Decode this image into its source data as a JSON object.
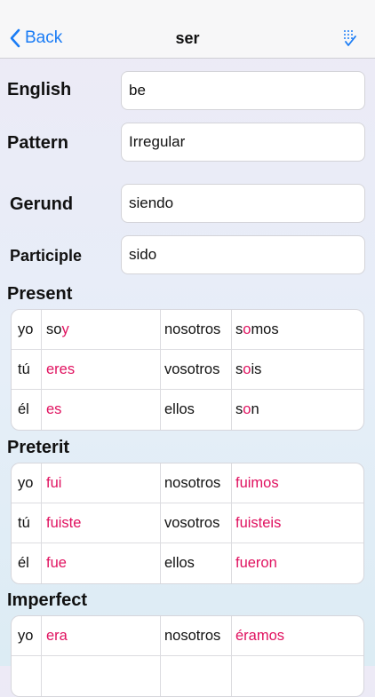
{
  "nav": {
    "back_label": "Back",
    "title": "ser",
    "action_icon": "checklist-icon"
  },
  "fields": {
    "english_label": "English",
    "english_value": "be",
    "pattern_label": "Pattern",
    "pattern_value": "Irregular",
    "gerund_label": "Gerund",
    "gerund_value": "siendo",
    "participle_label": "Participle",
    "participle_value": "sido"
  },
  "colors": {
    "accent": "#1a7cf5",
    "irregular": "#e0115f"
  },
  "tenses": {
    "present": {
      "title": "Present",
      "rows": [
        {
          "pronoun": "yo",
          "form": [
            [
              "so",
              "dark"
            ],
            [
              "y",
              "pink"
            ]
          ],
          "plural_pronoun": "nosotros",
          "plural_form": [
            [
              "s",
              "dark"
            ],
            [
              "o",
              "pink"
            ],
            [
              "mos",
              "dark"
            ]
          ]
        },
        {
          "pronoun": "tú",
          "form": [
            [
              "eres",
              "pink"
            ]
          ],
          "plural_pronoun": "vosotros",
          "plural_form": [
            [
              "s",
              "dark"
            ],
            [
              "o",
              "pink"
            ],
            [
              "is",
              "dark"
            ]
          ]
        },
        {
          "pronoun": "él",
          "form": [
            [
              "es",
              "pink"
            ]
          ],
          "plural_pronoun": "ellos",
          "plural_form": [
            [
              "s",
              "dark"
            ],
            [
              "o",
              "pink"
            ],
            [
              "n",
              "dark"
            ]
          ]
        }
      ]
    },
    "preterit": {
      "title": "Preterit",
      "rows": [
        {
          "pronoun": "yo",
          "form": [
            [
              "fui",
              "pink"
            ]
          ],
          "plural_pronoun": "nosotros",
          "plural_form": [
            [
              "fuimos",
              "pink"
            ]
          ]
        },
        {
          "pronoun": "tú",
          "form": [
            [
              "fuiste",
              "pink"
            ]
          ],
          "plural_pronoun": "vosotros",
          "plural_form": [
            [
              "fuisteis",
              "pink"
            ]
          ]
        },
        {
          "pronoun": "él",
          "form": [
            [
              "fue",
              "pink"
            ]
          ],
          "plural_pronoun": "ellos",
          "plural_form": [
            [
              "fueron",
              "pink"
            ]
          ]
        }
      ]
    },
    "imperfect": {
      "title": "Imperfect",
      "rows": [
        {
          "pronoun": "yo",
          "form": [
            [
              "era",
              "pink"
            ]
          ],
          "plural_pronoun": "nosotros",
          "plural_form": [
            [
              "éramos",
              "pink"
            ]
          ]
        },
        {
          "pronoun": "",
          "form": [],
          "plural_pronoun": "",
          "plural_form": []
        }
      ]
    }
  }
}
